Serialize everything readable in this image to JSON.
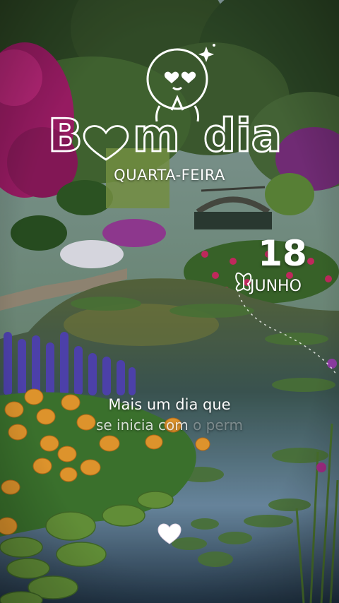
{
  "title": "Bom dia",
  "weekday": "QUARTA-FEIRA",
  "date": {
    "day": "18",
    "month": "JUNHO"
  },
  "message": {
    "line1": "Mais um dia que",
    "line2_visible": "se inicia com",
    "line2_faded": "o perm"
  },
  "icons": [
    "smiley-heart-eyes-icon",
    "sparkle-icon",
    "heart-icon",
    "butterfly-icon",
    "white-heart-icon"
  ],
  "colors": {
    "text": "#ffffff",
    "pond": "#2c4a5e",
    "foliage": "#3f6b34",
    "flowers_pink": "#c2237a",
    "flowers_orange": "#f0a030",
    "lupins": "#5b4fc4"
  }
}
